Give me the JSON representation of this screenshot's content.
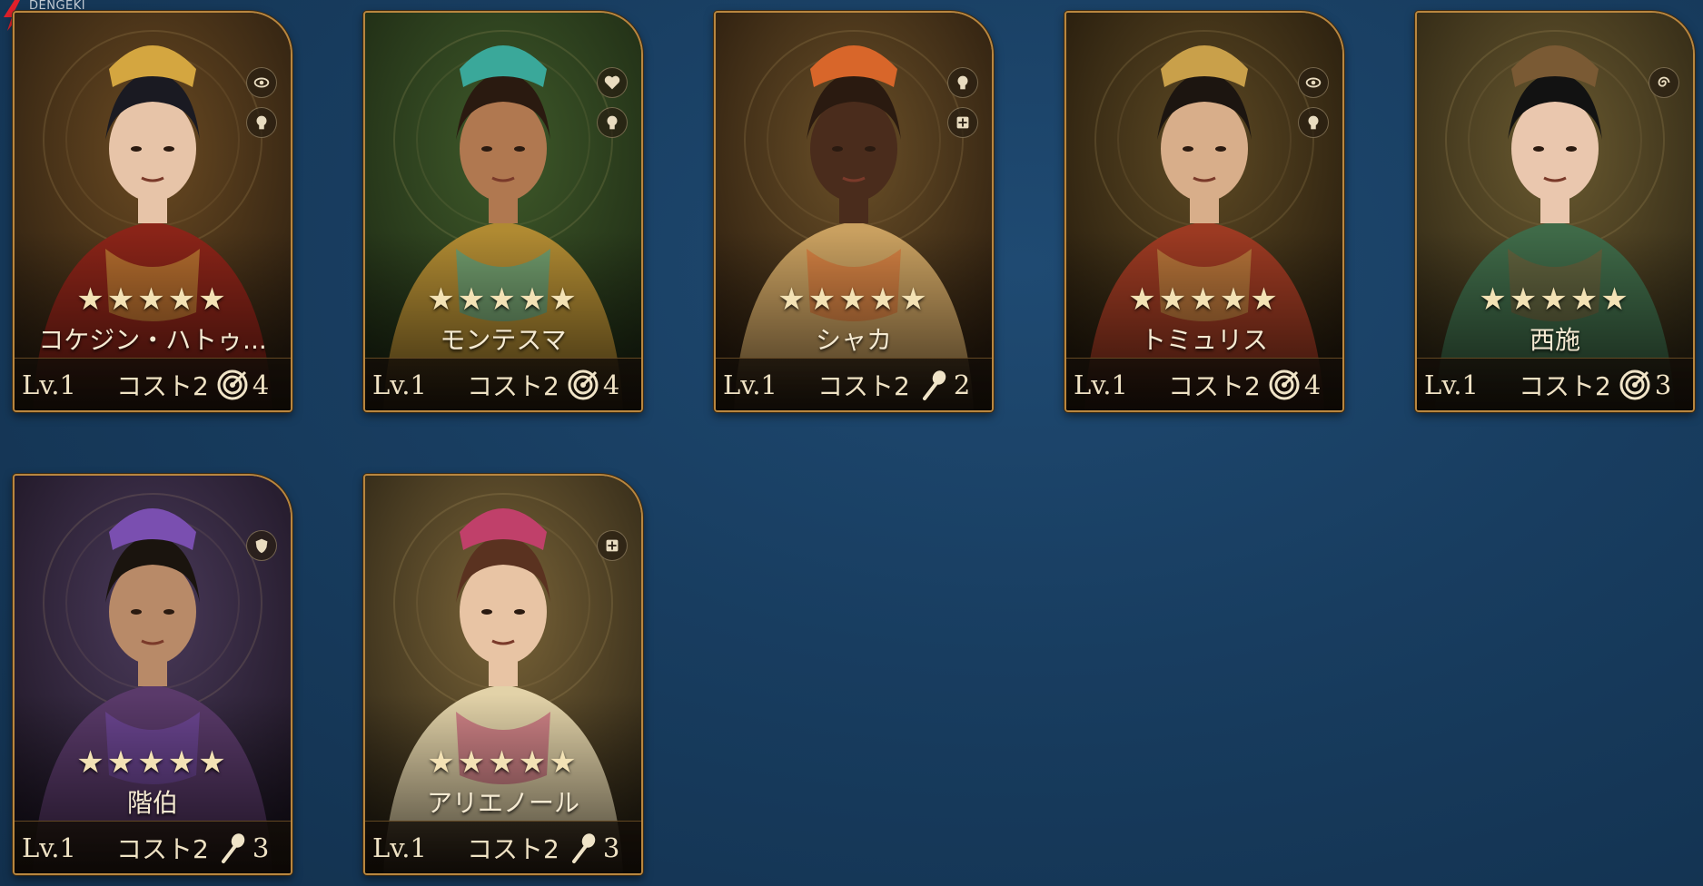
{
  "watermark": {
    "text": "DENGEKI ONLINE"
  },
  "cards": [
    {
      "name": "コケジン・ハトゥ...",
      "stars": "★★★★★",
      "level": "Lv.1",
      "cost": "コスト2",
      "role_icon": "target-icon",
      "role_value": "4",
      "badges": [
        "eye-badge-icon",
        "head-badge-icon"
      ]
    },
    {
      "name": "モンテスマ",
      "stars": "★★★★★",
      "level": "Lv.1",
      "cost": "コスト2",
      "role_icon": "target-icon",
      "role_value": "4",
      "badges": [
        "heart-badge-icon",
        "head-badge-icon"
      ]
    },
    {
      "name": "シャカ",
      "stars": "★★★★★",
      "level": "Lv.1",
      "cost": "コスト2",
      "role_icon": "club-icon",
      "role_value": "2",
      "badges": [
        "head-badge-icon",
        "medic-badge-icon"
      ]
    },
    {
      "name": "トミュリス",
      "stars": "★★★★★",
      "level": "Lv.1",
      "cost": "コスト2",
      "role_icon": "target-icon",
      "role_value": "4",
      "badges": [
        "eye-badge-icon",
        "head-badge-icon"
      ]
    },
    {
      "name": "西施",
      "stars": "★★★★★",
      "level": "Lv.1",
      "cost": "コスト2",
      "role_icon": "target-icon",
      "role_value": "3",
      "badges": [
        "spiral-badge-icon"
      ]
    },
    {
      "name": "階伯",
      "stars": "★★★★★",
      "level": "Lv.1",
      "cost": "コスト2",
      "role_icon": "club-icon",
      "role_value": "3",
      "badges": [
        "shield-badge-icon"
      ]
    },
    {
      "name": "アリエノール",
      "stars": "★★★★★",
      "level": "Lv.1",
      "cost": "コスト2",
      "role_icon": "club-icon",
      "role_value": "3",
      "badges": [
        "medic-badge-icon"
      ]
    }
  ]
}
